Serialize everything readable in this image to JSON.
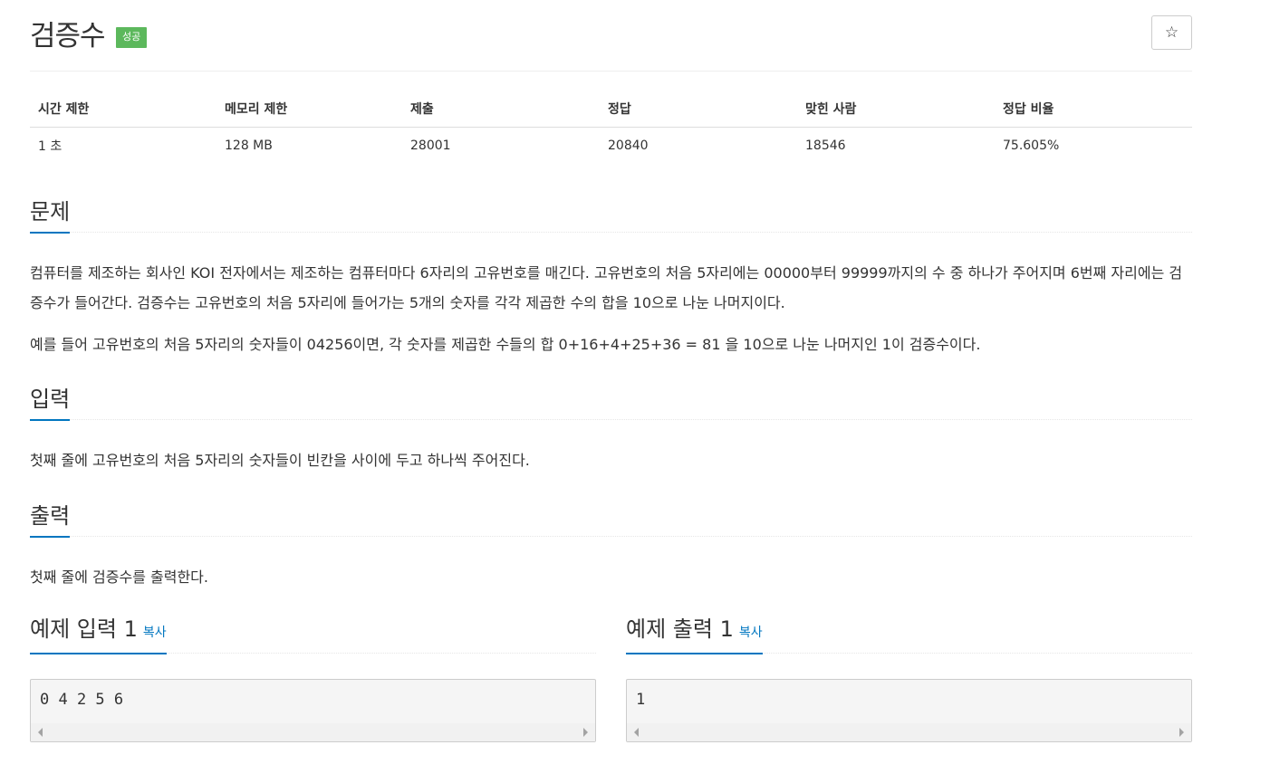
{
  "problem": {
    "title": "검증수",
    "badge": "성공",
    "star_icon": "☆"
  },
  "stats": {
    "headers": [
      "시간 제한",
      "메모리 제한",
      "제출",
      "정답",
      "맞힌 사람",
      "정답 비율"
    ],
    "values": [
      "1 초",
      "128 MB",
      "28001",
      "20840",
      "18546",
      "75.605%"
    ]
  },
  "sections": {
    "problem_title": "문제",
    "problem_p1": "컴퓨터를 제조하는 회사인 KOI 전자에서는 제조하는 컴퓨터마다 6자리의 고유번호를 매긴다. 고유번호의 처음 5자리에는 00000부터 99999까지의 수 중 하나가 주어지며 6번째 자리에는 검증수가 들어간다. 검증수는 고유번호의 처음 5자리에 들어가는 5개의 숫자를 각각 제곱한 수의 합을 10으로 나눈 나머지이다.",
    "problem_p2": "예를 들어 고유번호의 처음 5자리의 숫자들이 04256이면, 각 숫자를 제곱한 수들의 합 0+16+4+25+36 = 81 을 10으로 나눈 나머지인 1이 검증수이다.",
    "input_title": "입력",
    "input_p": "첫째 줄에 고유번호의 처음 5자리의 숫자들이 빈칸을 사이에 두고 하나씩 주어진다.",
    "output_title": "출력",
    "output_p": "첫째 줄에 검증수를 출력한다."
  },
  "samples": {
    "input_title": "예제 입력 1",
    "output_title": "예제 출력 1",
    "copy_label": "복사",
    "input_value": "0 4 2 5 6",
    "output_value": "1"
  }
}
